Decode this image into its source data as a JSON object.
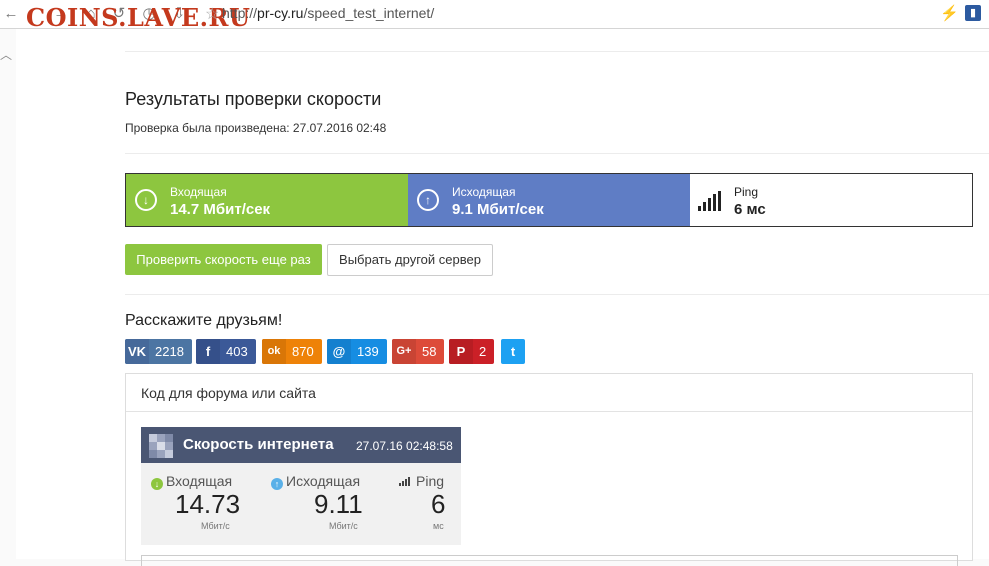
{
  "browser": {
    "url_prefix": "http://",
    "url_host": "pr-cy.ru",
    "url_path": "/speed_test_internet/",
    "watermark": "COINS.LAVE.RU"
  },
  "result": {
    "title": "Результаты проверки скорости",
    "date_line": "Проверка была произведена: 27.07.2016 02:48"
  },
  "speed": {
    "download_label": "Входящая",
    "download_value": "14.7 Мбит/сек",
    "upload_label": "Исходящая",
    "upload_value": "9.1 Мбит/сек",
    "ping_label": "Ping",
    "ping_value": "6 мс"
  },
  "actions": {
    "retest": "Проверить скорость еще раз",
    "change_server": "Выбрать другой сервер"
  },
  "share": {
    "title": "Расскажите друзьям!",
    "buttons": [
      {
        "network": "vk",
        "icon": "VK",
        "count": "2218",
        "color": "#4c75a3"
      },
      {
        "network": "facebook",
        "icon": "f",
        "count": "403",
        "color": "#3b5998"
      },
      {
        "network": "odnoklassniki",
        "icon": "ok",
        "count": "870",
        "color": "#ee8208"
      },
      {
        "network": "moimir",
        "icon": "@",
        "count": "139",
        "color": "#168de2"
      },
      {
        "network": "googleplus",
        "icon": "G+",
        "count": "58",
        "color": "#dd4b39"
      },
      {
        "network": "pinterest",
        "icon": "P",
        "count": "2",
        "color": "#cb2027"
      },
      {
        "network": "twitter",
        "icon": "t",
        "count": "",
        "color": "#1da1f2"
      }
    ]
  },
  "embed": {
    "panel_title": "Код для форума или сайта",
    "widget_title": "Скорость интернета",
    "widget_date": "27.07.16 02:48:58",
    "download_label": "Входящая",
    "download_value": "14.73",
    "upload_label": "Исходящая",
    "upload_value": "9.11",
    "ping_label": "Ping",
    "ping_value": "6",
    "speed_unit": "Мбит/с",
    "ping_unit": "мс"
  }
}
